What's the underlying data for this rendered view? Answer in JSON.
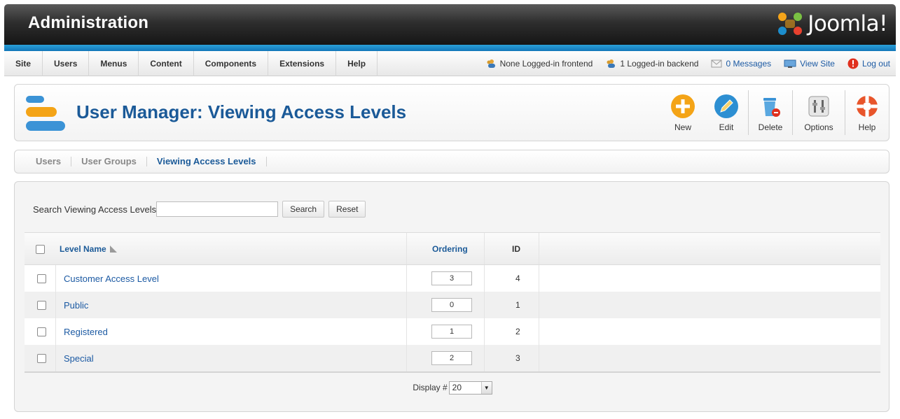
{
  "header": {
    "title": "Administration",
    "logo_text": "Joomla!"
  },
  "menu": {
    "items": [
      "Site",
      "Users",
      "Menus",
      "Content",
      "Components",
      "Extensions",
      "Help"
    ]
  },
  "status": {
    "frontend": "None Logged-in frontend",
    "backend": "1 Logged-in backend",
    "messages": "0 Messages",
    "view_site": "View Site",
    "logout": "Log out"
  },
  "page": {
    "title": "User Manager: Viewing Access Levels"
  },
  "toolbar": {
    "new": "New",
    "edit": "Edit",
    "delete": "Delete",
    "options": "Options",
    "help": "Help"
  },
  "submenu": {
    "users": "Users",
    "groups": "User Groups",
    "levels": "Viewing Access Levels",
    "active": "Viewing Access Levels"
  },
  "search": {
    "label": "Search Viewing Access Levels",
    "value": "",
    "search_btn": "Search",
    "reset_btn": "Reset"
  },
  "table": {
    "headers": {
      "level_name": "Level Name",
      "ordering": "Ordering",
      "id": "ID"
    },
    "rows": [
      {
        "name": "Customer Access Level",
        "ordering": "3",
        "id": "4"
      },
      {
        "name": "Public",
        "ordering": "0",
        "id": "1"
      },
      {
        "name": "Registered",
        "ordering": "1",
        "id": "2"
      },
      {
        "name": "Special",
        "ordering": "2",
        "id": "3"
      }
    ]
  },
  "footer": {
    "display_label": "Display #",
    "display_value": "20"
  },
  "colors": {
    "title_blue": "#1b5a98",
    "link_blue": "#1c5aa3",
    "accent_strip": "#1d8ac9",
    "new_orange": "#f4a417",
    "edit_blue": "#2d8fd2"
  }
}
